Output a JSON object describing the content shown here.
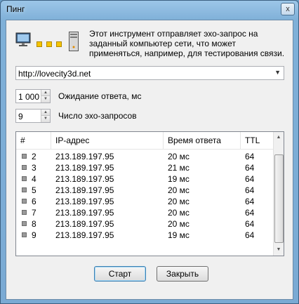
{
  "window": {
    "title": "Пинг",
    "close_glyph": "x"
  },
  "header": {
    "icons": [
      "monitor-icon",
      "packet-dot-icon",
      "server-icon"
    ],
    "description": "Этот инструмент отправляет эхо-запрос на заданный компьютер сети, что может применяться, например, для тестирования связи."
  },
  "host": {
    "value": "http://lovecity3d.net"
  },
  "timeout": {
    "value": "1 000",
    "label": "Ожидание ответа, мс"
  },
  "count": {
    "value": "9",
    "label": "Число эхо-запросов"
  },
  "table": {
    "columns": [
      "#",
      "IP-адрес",
      "Время ответа",
      "TTL"
    ],
    "rows": [
      {
        "n": "2",
        "ip": "213.189.197.95",
        "time": "20 мс",
        "ttl": "64"
      },
      {
        "n": "3",
        "ip": "213.189.197.95",
        "time": "21 мс",
        "ttl": "64"
      },
      {
        "n": "4",
        "ip": "213.189.197.95",
        "time": "19 мс",
        "ttl": "64"
      },
      {
        "n": "5",
        "ip": "213.189.197.95",
        "time": "20 мс",
        "ttl": "64"
      },
      {
        "n": "6",
        "ip": "213.189.197.95",
        "time": "20 мс",
        "ttl": "64"
      },
      {
        "n": "7",
        "ip": "213.189.197.95",
        "time": "20 мс",
        "ttl": "64"
      },
      {
        "n": "8",
        "ip": "213.189.197.95",
        "time": "20 мс",
        "ttl": "64"
      },
      {
        "n": "9",
        "ip": "213.189.197.95",
        "time": "19 мс",
        "ttl": "64"
      }
    ]
  },
  "buttons": {
    "start": "Старт",
    "close": "Закрыть"
  },
  "colors": {
    "titlebar": "#7fb0d8",
    "dot": "#f5c400",
    "client": "#f0f0f0"
  }
}
